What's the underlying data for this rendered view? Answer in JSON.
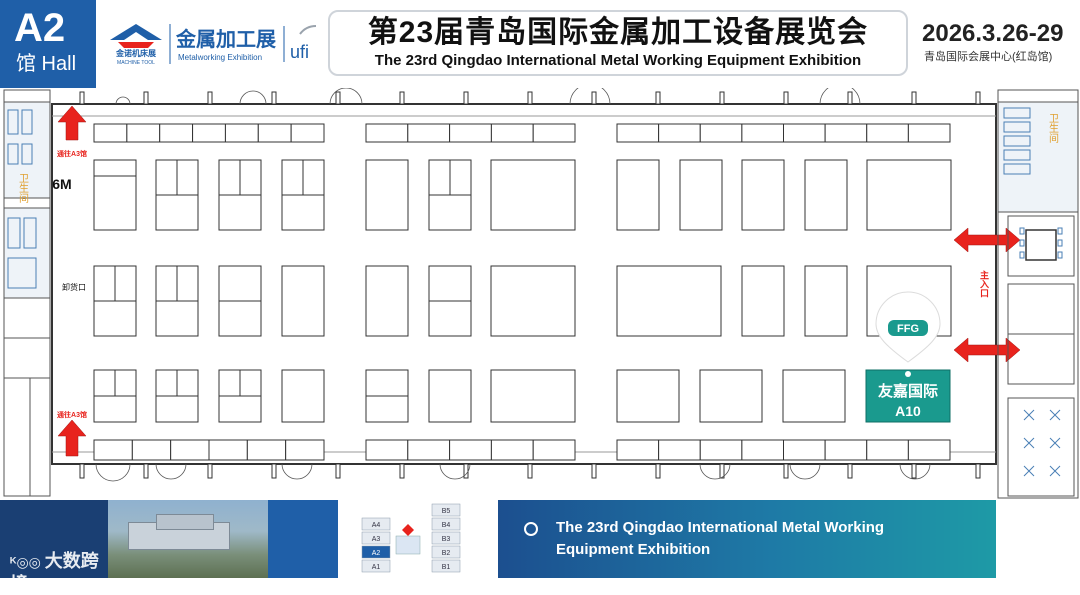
{
  "header": {
    "hall_code": "A2",
    "hall_sub": "馆 Hall",
    "logo_brand_top": "金诺机床展",
    "logo_brand_en": "MACHINE TOOL",
    "logo_exhibition_cn": "金属加工展",
    "logo_exhibition_en": "Metalworking Exhibition",
    "logo_ufi": "ufi",
    "title_cn": "第23届青岛国际金属加工设备展览会",
    "title_en": "The 23rd Qingdao International Metal Working Equipment Exhibition",
    "date": "2026.3.26-29",
    "venue": "青岛国际会展中心(红岛馆)"
  },
  "map": {
    "label_to_a3_top": "通往A3馆",
    "label_to_a3_bottom": "通往A3馆",
    "label_6m": "6M",
    "label_unload": "卸货口",
    "label_restroom_left": "卫生间",
    "label_restroom_right": "卫生间",
    "label_main_entrance": "主入口",
    "booth_logo": "FFG",
    "booth_company": "友嘉国际",
    "booth_number": "A10",
    "colors": {
      "arrow": "#e8231d",
      "booth_highlight": "#1a9a8e",
      "hall_blue": "#1f5fa8"
    }
  },
  "mini_map": {
    "left_halls": [
      "A4",
      "A3",
      "A2",
      "A1"
    ],
    "right_halls": [
      "B5",
      "B4",
      "B3",
      "B2",
      "B1"
    ],
    "active_hall": "A2"
  },
  "footer": {
    "info_line_1": "The 23rd Qingdao International Metal Working",
    "info_line_2": "Equipment Exhibition",
    "watermark": "大数跨境"
  }
}
